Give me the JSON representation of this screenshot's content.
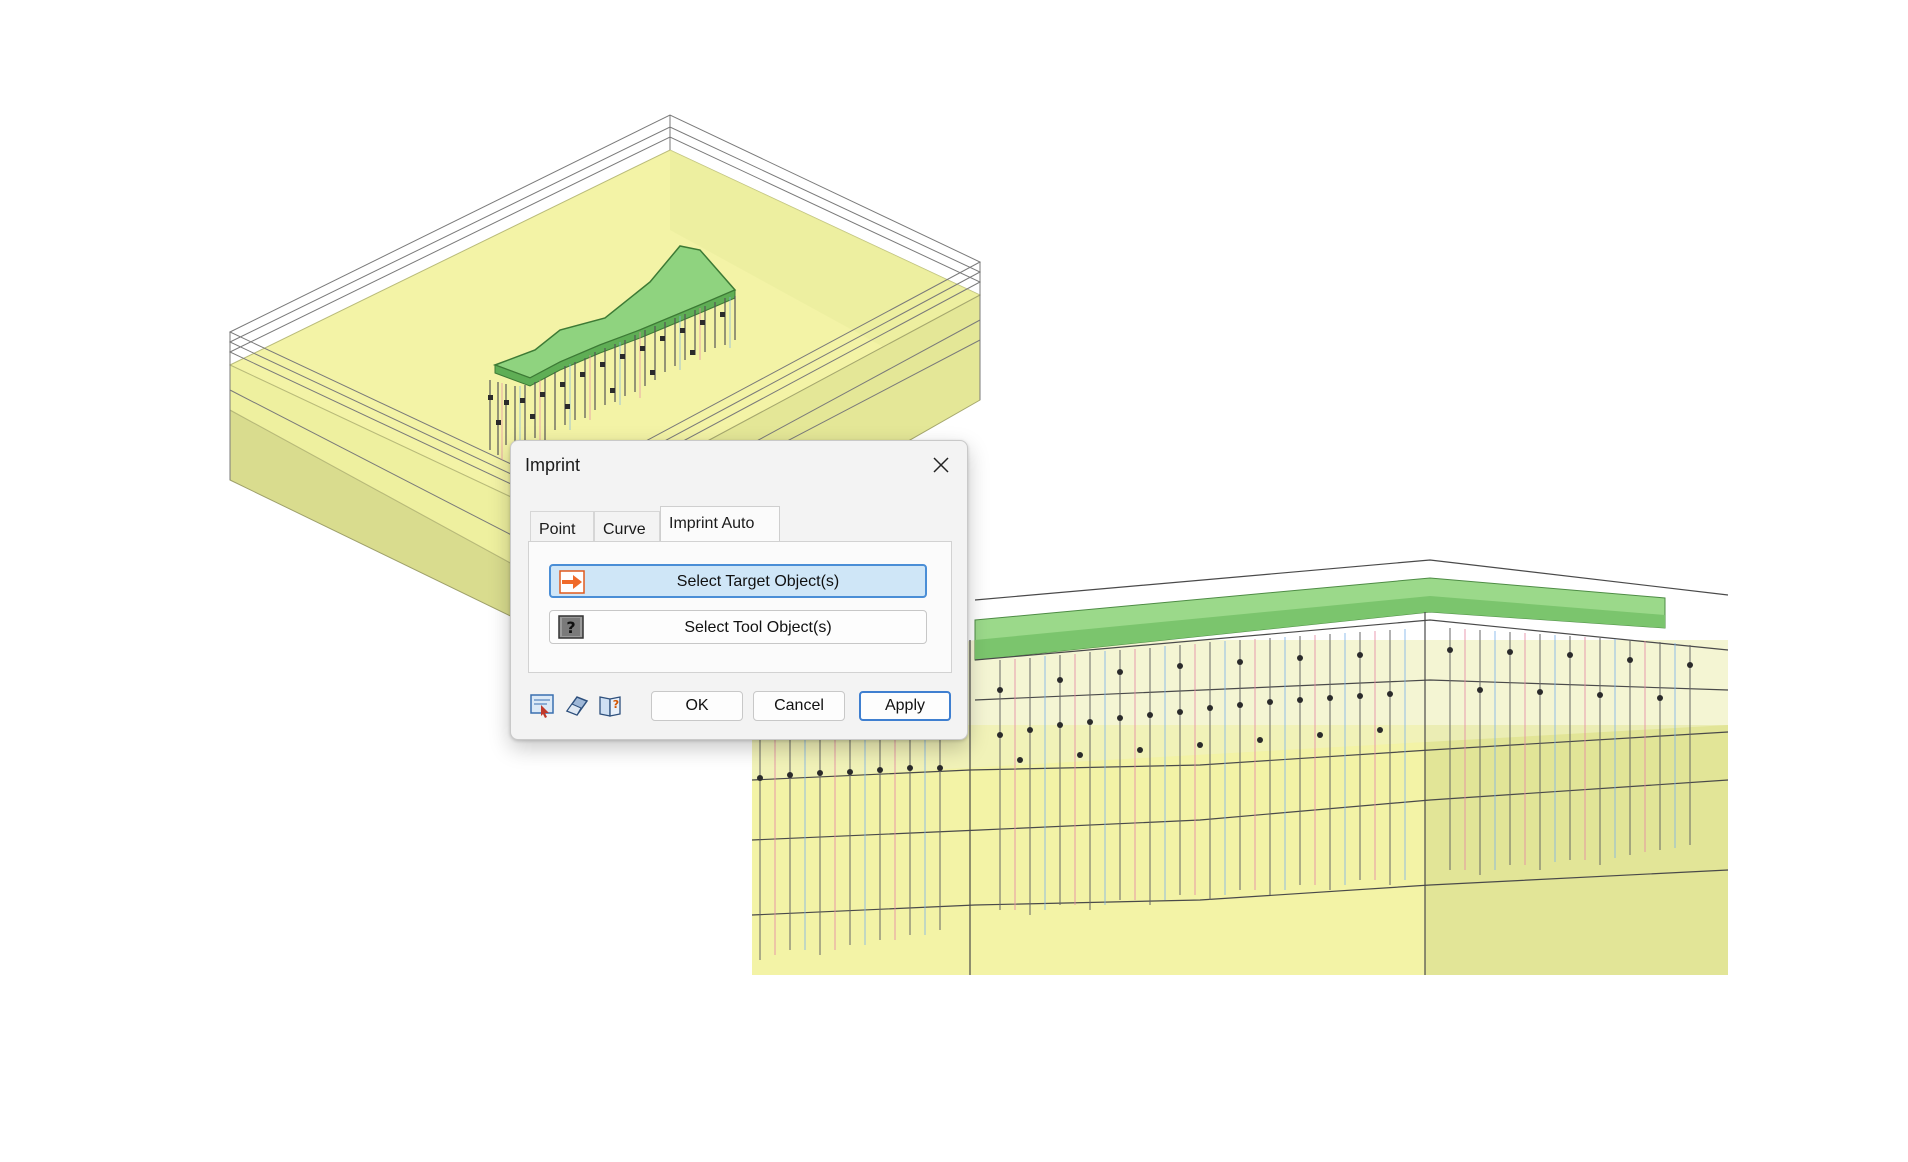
{
  "dialog": {
    "title": "Imprint",
    "tabs": [
      "Point",
      "Curve",
      "Imprint Auto"
    ],
    "active_tab": "Imprint Auto",
    "select_target_label": "Select Target Object(s)",
    "select_tool_label": "Select Tool Object(s)",
    "ok_label": "OK",
    "cancel_label": "Cancel",
    "apply_label": "Apply",
    "icons": {
      "close": "close-icon",
      "target": "arrow-right-icon",
      "tool": "question-icon",
      "footer": [
        "select-view-icon",
        "eraser-icon",
        "help-book-icon"
      ]
    }
  },
  "colors": {
    "soil_light": "#f3f3a4",
    "soil_mid": "#e7ea98",
    "soil_dark": "#d2d68a",
    "raft_green": "#8fd37f",
    "accent_blue": "#3f7fd0",
    "target_fill": "#cfe6f7",
    "arrow_orange": "#f06a2a"
  }
}
